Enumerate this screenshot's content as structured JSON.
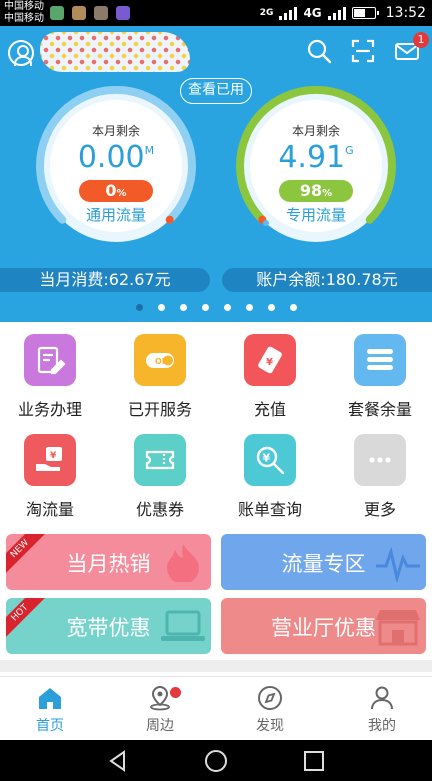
{
  "status_bar": {
    "carrier_1": "中国移动",
    "carrier_2": "中国移动",
    "net_1": "2G",
    "net_2": "4G",
    "net_3": "4G",
    "time": "13:52"
  },
  "header": {
    "message_badge_count": "1",
    "check_used_label": "查看已用"
  },
  "gauges": [
    {
      "label": "本月剩余",
      "value": "0.00",
      "unit": "M",
      "percent": "0",
      "percent_sign": "%",
      "type_label": "通用流量",
      "percent_color": "#f25a28",
      "ring_color": "#8fd0f2"
    },
    {
      "label": "本月剩余",
      "value": "4.91",
      "unit": "G",
      "percent": "98",
      "percent_sign": "%",
      "type_label": "专用流量",
      "percent_color": "#8cc63f",
      "ring_color": "#8cc63f"
    }
  ],
  "summary": {
    "monthly_spend": "当月消费:62.67元",
    "account_balance": "账户余额:180.78元"
  },
  "carousel": {
    "pages": 8,
    "active_index": 0
  },
  "services": [
    {
      "label": "业务办理",
      "icon": "form-edit-icon",
      "color": "#c978dd"
    },
    {
      "label": "已开服务",
      "icon": "toggle-on-icon",
      "color": "#f6b52a"
    },
    {
      "label": "充值",
      "icon": "recharge-card-icon",
      "color": "#f2555a"
    },
    {
      "label": "套餐余量",
      "icon": "list-icon",
      "color": "#62b8ef"
    },
    {
      "label": "淘流量",
      "icon": "hand-coin-icon",
      "color": "#ef5a5e"
    },
    {
      "label": "优惠券",
      "icon": "coupon-icon",
      "color": "#5ccfc8"
    },
    {
      "label": "账单查询",
      "icon": "search-yen-icon",
      "color": "#4dc9d6"
    },
    {
      "label": "更多",
      "icon": "more-icon",
      "color": "#d9d9d9"
    }
  ],
  "banners": [
    {
      "label": "当月热销",
      "ribbon": "NEW",
      "color": "#f58c9b"
    },
    {
      "label": "流量专区",
      "ribbon": "",
      "color": "#6fa6ec"
    },
    {
      "label": "宽带优惠",
      "ribbon": "HOT",
      "color": "#76d3cc"
    },
    {
      "label": "营业厅优惠",
      "ribbon": "",
      "color": "#ef8a8a"
    }
  ],
  "bottom_nav": [
    {
      "label": "首页",
      "icon": "home-icon",
      "active": true
    },
    {
      "label": "周边",
      "icon": "location-icon",
      "active": false,
      "dot": true
    },
    {
      "label": "发现",
      "icon": "compass-icon",
      "active": false
    },
    {
      "label": "我的",
      "icon": "user-icon",
      "active": false
    }
  ],
  "colors": {
    "primary": "#2aa4e0",
    "accent_dark": "#1f84c2",
    "badge": "#e4393c"
  }
}
